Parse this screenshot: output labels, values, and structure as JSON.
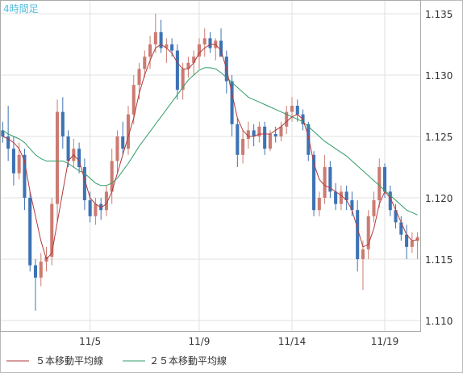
{
  "header": {
    "timeframe_label": "4時間足"
  },
  "legend": {
    "ma5_label": "５本移動平均線",
    "ma25_label": "２５本移動平均線"
  },
  "colors": {
    "up_candle": "#cc7b72",
    "down_candle": "#3d73b5",
    "ma5": "#b23a3a",
    "ma25": "#2f9e68",
    "grid": "#e0e0e0",
    "axis": "#888888",
    "text": "#333333",
    "title": "#55bbdd"
  },
  "chart_data": {
    "type": "candlestick",
    "title": "4時間足",
    "xlabel": "",
    "ylabel": "",
    "ylim": [
      1.11,
      1.135
    ],
    "y_ticks": [
      "1.110",
      "1.115",
      "1.120",
      "1.125",
      "1.130",
      "1.135"
    ],
    "x_ticks": [
      {
        "index": 16,
        "label": "11/5"
      },
      {
        "index": 36,
        "label": "11/9"
      },
      {
        "index": 53,
        "label": "11/14"
      },
      {
        "index": 70,
        "label": "11/19"
      }
    ],
    "grid": true,
    "legend_position": "bottom",
    "series": [
      {
        "name": "５本移動平均線"
      },
      {
        "name": "２５本移動平均線"
      }
    ],
    "ohlc": [
      [
        1.1255,
        1.1262,
        1.1245,
        1.125
      ],
      [
        1.125,
        1.1275,
        1.123,
        1.124
      ],
      [
        1.124,
        1.125,
        1.121,
        1.122
      ],
      [
        1.122,
        1.1245,
        1.1215,
        1.1235
      ],
      [
        1.1235,
        1.124,
        1.119,
        1.12
      ],
      [
        1.12,
        1.1205,
        1.114,
        1.1145
      ],
      [
        1.1145,
        1.115,
        1.1108,
        1.1135
      ],
      [
        1.1135,
        1.1155,
        1.1128,
        1.1148
      ],
      [
        1.1148,
        1.116,
        1.114,
        1.1152
      ],
      [
        1.1152,
        1.12,
        1.1145,
        1.1195
      ],
      [
        1.1195,
        1.128,
        1.118,
        1.127
      ],
      [
        1.127,
        1.1282,
        1.124,
        1.125
      ],
      [
        1.125,
        1.1255,
        1.1225,
        1.123
      ],
      [
        1.123,
        1.1248,
        1.1225,
        1.124
      ],
      [
        1.124,
        1.1245,
        1.122,
        1.1225
      ],
      [
        1.1225,
        1.1232,
        1.119,
        1.1198
      ],
      [
        1.1198,
        1.1205,
        1.118,
        1.1185
      ],
      [
        1.1185,
        1.12,
        1.1178,
        1.1195
      ],
      [
        1.1195,
        1.12,
        1.1182,
        1.119
      ],
      [
        1.119,
        1.121,
        1.1185,
        1.1205
      ],
      [
        1.1205,
        1.124,
        1.1195,
        1.123
      ],
      [
        1.123,
        1.1255,
        1.122,
        1.125
      ],
      [
        1.125,
        1.1262,
        1.1235,
        1.124
      ],
      [
        1.124,
        1.1275,
        1.1235,
        1.1268
      ],
      [
        1.1268,
        1.13,
        1.126,
        1.1292
      ],
      [
        1.1292,
        1.131,
        1.128,
        1.1305
      ],
      [
        1.1305,
        1.132,
        1.1298,
        1.1315
      ],
      [
        1.1315,
        1.1332,
        1.1305,
        1.1325
      ],
      [
        1.1325,
        1.135,
        1.1318,
        1.1335
      ],
      [
        1.1335,
        1.1345,
        1.1318,
        1.1322
      ],
      [
        1.1322,
        1.133,
        1.131,
        1.1325
      ],
      [
        1.1325,
        1.133,
        1.1315,
        1.132
      ],
      [
        1.132,
        1.1325,
        1.128,
        1.1288
      ],
      [
        1.1288,
        1.131,
        1.128,
        1.1305
      ],
      [
        1.1305,
        1.1315,
        1.1298,
        1.131
      ],
      [
        1.131,
        1.132,
        1.13,
        1.1315
      ],
      [
        1.1315,
        1.133,
        1.1305,
        1.1325
      ],
      [
        1.1325,
        1.1338,
        1.1315,
        1.133
      ],
      [
        1.133,
        1.1335,
        1.1318,
        1.1322
      ],
      [
        1.1322,
        1.133,
        1.1312,
        1.1328
      ],
      [
        1.1328,
        1.1338,
        1.132,
        1.1315
      ],
      [
        1.1315,
        1.132,
        1.1285,
        1.1295
      ],
      [
        1.1295,
        1.13,
        1.125,
        1.126
      ],
      [
        1.126,
        1.1265,
        1.1225,
        1.1235
      ],
      [
        1.1235,
        1.1255,
        1.1228,
        1.1248
      ],
      [
        1.1248,
        1.1262,
        1.124,
        1.1255
      ],
      [
        1.1255,
        1.126,
        1.1242,
        1.125
      ],
      [
        1.125,
        1.1262,
        1.1245,
        1.1258
      ],
      [
        1.1258,
        1.1262,
        1.1235,
        1.124
      ],
      [
        1.124,
        1.1255,
        1.1238,
        1.1252
      ],
      [
        1.1252,
        1.1258,
        1.1245,
        1.125
      ],
      [
        1.125,
        1.1262,
        1.1246,
        1.1258
      ],
      [
        1.1258,
        1.1275,
        1.1252,
        1.127
      ],
      [
        1.127,
        1.1282,
        1.1262,
        1.1275
      ],
      [
        1.1275,
        1.128,
        1.1262,
        1.1268
      ],
      [
        1.1268,
        1.1272,
        1.1255,
        1.126
      ],
      [
        1.126,
        1.1262,
        1.123,
        1.1235
      ],
      [
        1.1235,
        1.1238,
        1.1185,
        1.119
      ],
      [
        1.119,
        1.1205,
        1.1185,
        1.12
      ],
      [
        1.12,
        1.1235,
        1.1195,
        1.1225
      ],
      [
        1.1225,
        1.123,
        1.12,
        1.1205
      ],
      [
        1.1205,
        1.1212,
        1.119,
        1.1195
      ],
      [
        1.1195,
        1.121,
        1.119,
        1.1205
      ],
      [
        1.1205,
        1.121,
        1.119,
        1.1198
      ],
      [
        1.1198,
        1.1205,
        1.1185,
        1.119
      ],
      [
        1.119,
        1.1198,
        1.114,
        1.115
      ],
      [
        1.115,
        1.1165,
        1.1125,
        1.1158
      ],
      [
        1.1158,
        1.119,
        1.115,
        1.1185
      ],
      [
        1.1185,
        1.1205,
        1.118,
        1.1198
      ],
      [
        1.1198,
        1.1232,
        1.1192,
        1.1225
      ],
      [
        1.1225,
        1.1228,
        1.12,
        1.1205
      ],
      [
        1.1205,
        1.121,
        1.1185,
        1.119
      ],
      [
        1.119,
        1.1195,
        1.1175,
        1.118
      ],
      [
        1.118,
        1.1185,
        1.1165,
        1.117
      ],
      [
        1.117,
        1.1178,
        1.115,
        1.116
      ],
      [
        1.116,
        1.1172,
        1.1155,
        1.1165
      ],
      [
        1.1165,
        1.1172,
        1.115,
        1.1168
      ]
    ],
    "ma5": [
      1.125,
      1.1248,
      1.1245,
      1.124,
      1.123,
      1.1205,
      1.1185,
      1.1165,
      1.115,
      1.1155,
      1.118,
      1.1205,
      1.123,
      1.1235,
      1.123,
      1.1215,
      1.12,
      1.1195,
      1.1192,
      1.1195,
      1.1205,
      1.122,
      1.1235,
      1.125,
      1.1265,
      1.1285,
      1.13,
      1.1312,
      1.1322,
      1.1325,
      1.1322,
      1.1318,
      1.131,
      1.1305,
      1.1305,
      1.131,
      1.1318,
      1.1322,
      1.1325,
      1.1325,
      1.132,
      1.1305,
      1.1285,
      1.1265,
      1.1255,
      1.125,
      1.125,
      1.1252,
      1.1252,
      1.1252,
      1.1255,
      1.1258,
      1.1262,
      1.1266,
      1.1268,
      1.1264,
      1.125,
      1.1228,
      1.1215,
      1.121,
      1.1208,
      1.1205,
      1.1202,
      1.1198,
      1.119,
      1.1175,
      1.116,
      1.1162,
      1.1175,
      1.1195,
      1.1205,
      1.12,
      1.119,
      1.118,
      1.117,
      1.1165,
      1.1166
    ],
    "ma25": [
      1.1255,
      1.1252,
      1.125,
      1.1248,
      1.1245,
      1.124,
      1.1235,
      1.1232,
      1.123,
      1.123,
      1.123,
      1.123,
      1.1228,
      1.1225,
      1.1222,
      1.122,
      1.1216,
      1.1212,
      1.121,
      1.121,
      1.1212,
      1.1216,
      1.1222,
      1.1228,
      1.1235,
      1.1242,
      1.1248,
      1.1254,
      1.126,
      1.1266,
      1.1272,
      1.1278,
      1.1284,
      1.129,
      1.1296,
      1.13,
      1.1304,
      1.1306,
      1.1306,
      1.1305,
      1.1302,
      1.1298,
      1.1294,
      1.129,
      1.1286,
      1.1282,
      1.128,
      1.1278,
      1.1276,
      1.1274,
      1.1272,
      1.127,
      1.1268,
      1.1266,
      1.1264,
      1.1262,
      1.1258,
      1.1254,
      1.125,
      1.1246,
      1.1243,
      1.124,
      1.1237,
      1.1234,
      1.123,
      1.1226,
      1.1222,
      1.1218,
      1.1214,
      1.121,
      1.1206,
      1.1202,
      1.1198,
      1.1194,
      1.119,
      1.1188,
      1.1186
    ]
  }
}
